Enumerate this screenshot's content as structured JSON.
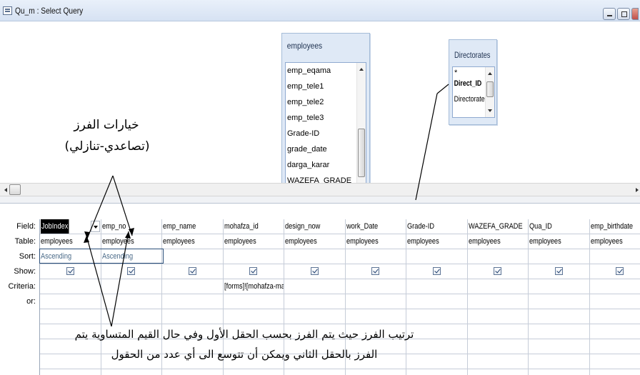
{
  "window": {
    "title": "Qu_m : Select Query"
  },
  "tables": [
    {
      "name": "employees",
      "fields": [
        "emp_eqama",
        "emp_tele1",
        "emp_tele2",
        "emp_tele3",
        "Grade-ID",
        "grade_date",
        "darga_karar",
        "WAZEFA_GRADE"
      ]
    },
    {
      "name": "Directorates",
      "fields": [
        "*",
        "Direct_ID",
        "Directorate"
      ]
    }
  ],
  "grid": {
    "row_labels": [
      "Field:",
      "Table:",
      "Sort:",
      "Show:",
      "Criteria:",
      "or:"
    ],
    "columns": [
      {
        "field": "JobIndex",
        "table": "employees",
        "sort": "Ascending",
        "show": true,
        "criteria": ""
      },
      {
        "field": "emp_no",
        "table": "employees",
        "sort": "Ascending",
        "show": true,
        "criteria": ""
      },
      {
        "field": "emp_name",
        "table": "employees",
        "sort": "",
        "show": true,
        "criteria": ""
      },
      {
        "field": "mohafza_id",
        "table": "employees",
        "sort": "",
        "show": true,
        "criteria": "[forms]![mohafza-main]"
      },
      {
        "field": "design_now",
        "table": "employees",
        "sort": "",
        "show": true,
        "criteria": ""
      },
      {
        "field": "work_Date",
        "table": "employees",
        "sort": "",
        "show": true,
        "criteria": ""
      },
      {
        "field": "Grade-ID",
        "table": "employees",
        "sort": "",
        "show": true,
        "criteria": ""
      },
      {
        "field": "WAZEFA_GRADE",
        "table": "employees",
        "sort": "",
        "show": true,
        "criteria": ""
      },
      {
        "field": "Qua_ID",
        "table": "employees",
        "sort": "",
        "show": true,
        "criteria": ""
      },
      {
        "field": "emp_birthdate",
        "table": "employees",
        "sort": "",
        "show": true,
        "criteria": ""
      }
    ]
  },
  "annotations": {
    "sort_options_line1": "خيارات الفرز",
    "sort_options_line2": "(تصاعدي-تنازلي)",
    "sort_order_line1": "ترتيب الفرز حيث يتم الفرز بحسب الحقل الأول وفي حال القيم المتساوية يتم",
    "sort_order_line2": "الفرز بالحقل الثاني ويمكن أن تتوسع الى أي عدد من الحقول"
  }
}
